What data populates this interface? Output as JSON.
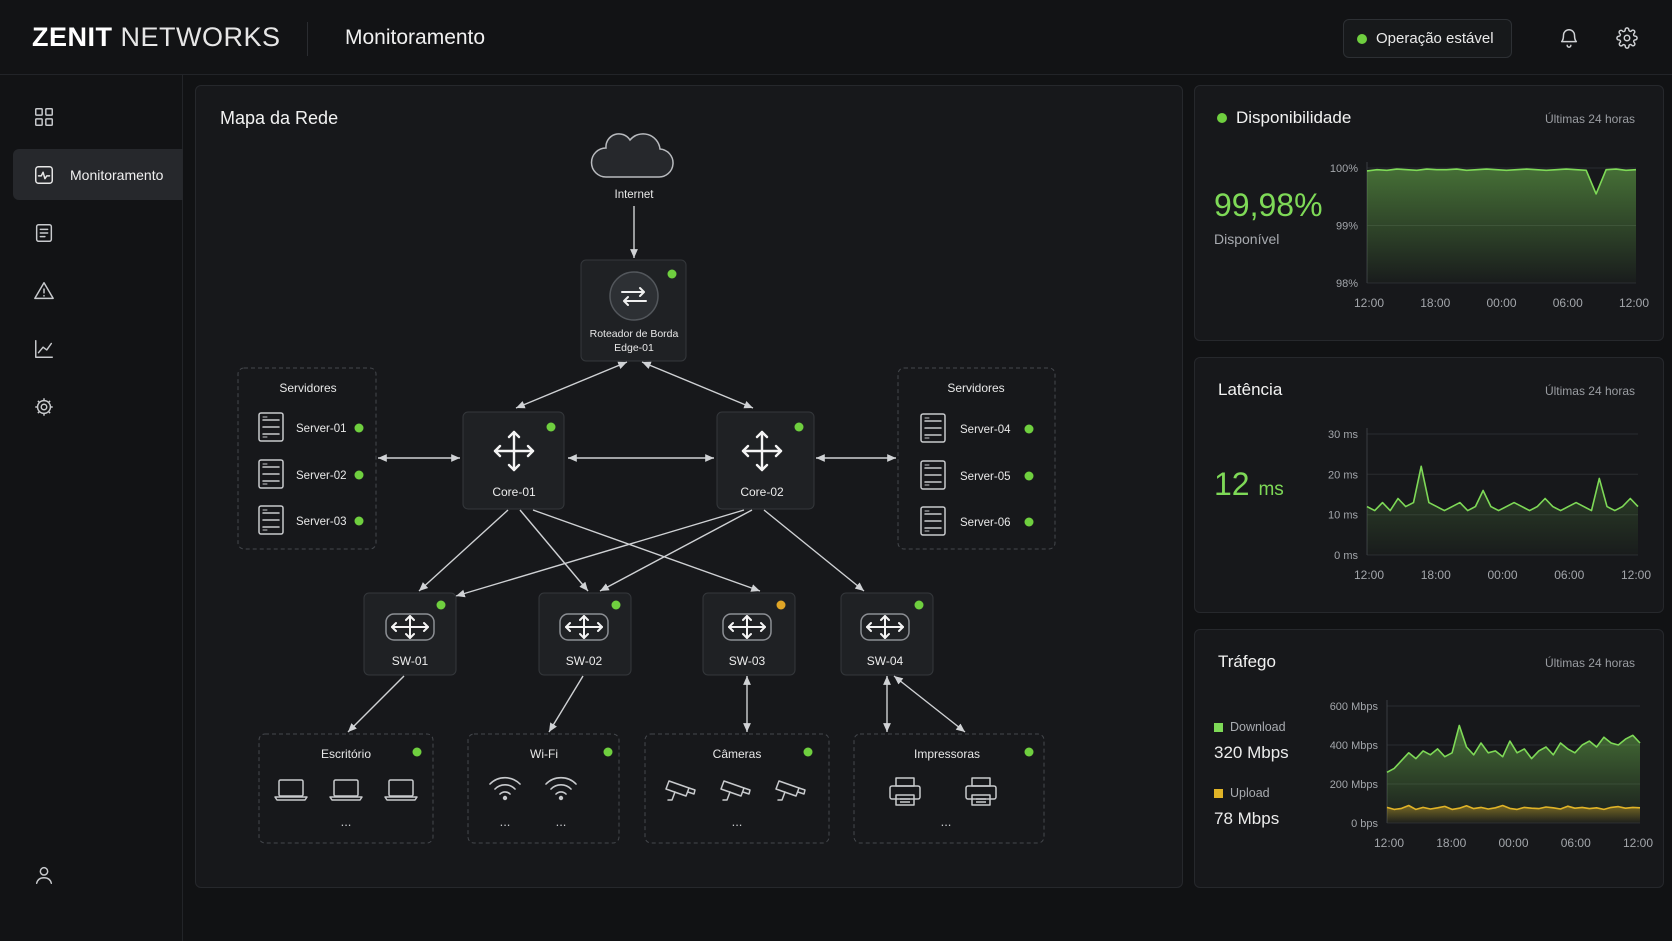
{
  "header": {
    "brand_bold": "ZENIT",
    "brand_light": "NETWORKS",
    "page_title": "Monitoramento",
    "status": "Operação estável"
  },
  "sidebar": {
    "items": [
      {
        "icon": "dashboard-icon",
        "label": ""
      },
      {
        "icon": "monitor-icon",
        "label": "Monitoramento"
      },
      {
        "icon": "document-icon",
        "label": ""
      },
      {
        "icon": "warning-icon",
        "label": ""
      },
      {
        "icon": "chart-icon",
        "label": ""
      },
      {
        "icon": "gear-icon",
        "label": ""
      },
      {
        "icon": "user-icon",
        "label": ""
      }
    ]
  },
  "network_map": {
    "title": "Mapa da Rede",
    "internet": "Internet",
    "edge_router": {
      "line1": "Roteador de Borda",
      "line2": "Edge-01",
      "status": "ok"
    },
    "cores": [
      {
        "label": "Core-01",
        "status": "ok"
      },
      {
        "label": "Core-02",
        "status": "ok"
      }
    ],
    "server_groups": [
      {
        "title": "Servidores",
        "servers": [
          {
            "name": "Server-01",
            "status": "ok"
          },
          {
            "name": "Server-02",
            "status": "ok"
          },
          {
            "name": "Server-03",
            "status": "ok"
          }
        ]
      },
      {
        "title": "Servidores",
        "servers": [
          {
            "name": "Server-04",
            "status": "ok"
          },
          {
            "name": "Server-05",
            "status": "ok"
          },
          {
            "name": "Server-06",
            "status": "ok"
          }
        ]
      }
    ],
    "switches": [
      {
        "label": "SW-01",
        "status": "ok"
      },
      {
        "label": "SW-02",
        "status": "ok"
      },
      {
        "label": "SW-03",
        "status": "warning"
      },
      {
        "label": "SW-04",
        "status": "ok"
      }
    ],
    "endpoint_groups": [
      {
        "title": "Escritório",
        "icon": "laptop-icon",
        "status": "ok",
        "more": "..."
      },
      {
        "title": "Wi-Fi",
        "icon": "wifi-icon",
        "status": "ok",
        "more": "..."
      },
      {
        "title": "Câmeras",
        "icon": "camera-icon",
        "status": "ok",
        "more": "..."
      },
      {
        "title": "Impressoras",
        "icon": "printer-icon",
        "status": "ok",
        "more": "..."
      }
    ],
    "colors": {
      "ok": "#6fcf3f",
      "warning": "#e0a526"
    }
  },
  "availability": {
    "title": "Disponibilidade",
    "period": "Últimas 24 horas",
    "value": "99,98%",
    "caption": "Disponível"
  },
  "latency": {
    "title": "Latência",
    "period": "Últimas 24 horas",
    "value": "12",
    "unit": "ms"
  },
  "traffic": {
    "title": "Tráfego",
    "period": "Últimas 24 horas",
    "download_label": "Download",
    "download_value": "320 Mbps",
    "upload_label": "Upload",
    "upload_value": "78 Mbps"
  },
  "chart_data": [
    {
      "type": "area",
      "title": "Disponibilidade",
      "x": [
        "12:00",
        "18:00",
        "00:00",
        "06:00",
        "12:00"
      ],
      "yticks": [
        "100%",
        "99%",
        "98%"
      ],
      "ylim": [
        98,
        100
      ],
      "series": [
        {
          "values": [
            99.95,
            99.97,
            99.96,
            99.98,
            99.97,
            99.96,
            99.98,
            99.97,
            99.97,
            99.98,
            99.96,
            99.97,
            99.98,
            99.97,
            99.96,
            99.97,
            99.98,
            99.97,
            99.96,
            99.97,
            99.98,
            99.97,
            99.96,
            99.55,
            99.97,
            99.98,
            99.96,
            99.97
          ]
        }
      ],
      "color": "#7ed957"
    },
    {
      "type": "line",
      "title": "Latência",
      "x": [
        "12:00",
        "18:00",
        "00:00",
        "06:00",
        "12:00"
      ],
      "yticks": [
        "30 ms",
        "20 ms",
        "10 ms",
        "0 ms"
      ],
      "ylim": [
        0,
        30
      ],
      "series": [
        {
          "values": [
            12,
            11,
            13,
            11,
            14,
            12,
            13,
            22,
            13,
            12,
            11,
            12,
            13,
            11,
            12,
            16,
            12,
            11,
            12,
            13,
            12,
            11,
            12,
            14,
            12,
            11,
            12,
            13,
            12,
            11,
            19,
            12,
            11,
            12,
            14,
            12
          ]
        }
      ],
      "color": "#7ed957"
    },
    {
      "type": "area",
      "title": "Tráfego",
      "x": [
        "12:00",
        "18:00",
        "00:00",
        "06:00",
        "12:00"
      ],
      "yticks": [
        "600 Mbps",
        "400 Mbps",
        "200 Mbps",
        "0 bps"
      ],
      "ylim": [
        0,
        600
      ],
      "series": [
        {
          "name": "Download",
          "values": [
            260,
            280,
            320,
            360,
            330,
            370,
            350,
            380,
            340,
            360,
            500,
            390,
            350,
            410,
            360,
            370,
            340,
            420,
            360,
            380,
            330,
            370,
            390,
            350,
            410,
            380,
            360,
            400,
            420,
            390,
            440,
            410,
            400,
            430,
            450,
            410
          ],
          "color": "#7ed957"
        },
        {
          "name": "Upload",
          "values": [
            80,
            70,
            75,
            90,
            70,
            80,
            72,
            78,
            85,
            70,
            76,
            88,
            74,
            80,
            72,
            78,
            90,
            75,
            70,
            80,
            76,
            74,
            82,
            78,
            72,
            86,
            76,
            80,
            74,
            78,
            70,
            80,
            84,
            76,
            80,
            78
          ],
          "color": "#e0b327"
        }
      ]
    }
  ]
}
